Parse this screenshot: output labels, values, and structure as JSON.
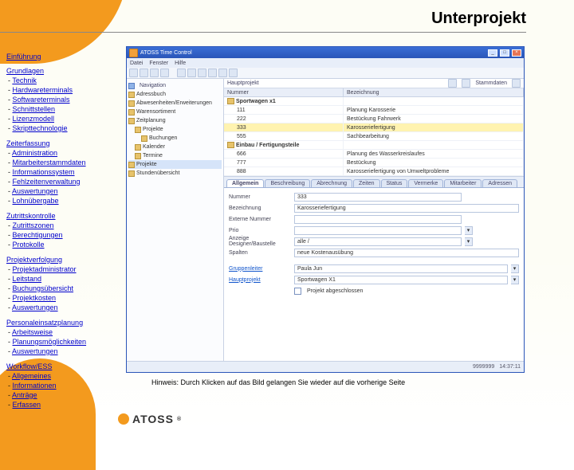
{
  "page": {
    "title": "Unterprojekt"
  },
  "nav": {
    "einfuehrung": "Einführung",
    "grundlagen": {
      "title": "Grundlagen",
      "items": [
        "Technik",
        "Hardwareterminals",
        "Softwareterminals",
        "Schnittstellen",
        "Lizenzmodell",
        "Skripttechnologie"
      ]
    },
    "zeiterfassung": {
      "title": "Zeiterfassung",
      "items": [
        "Administration",
        "Mitarbeiterstammdaten",
        "Informationssystem",
        "Fehlzeitenverwaltung",
        "Auswertungen",
        "Lohnübergabe"
      ]
    },
    "zutritt": {
      "title": "Zutrittskontrolle",
      "items": [
        "Zutrittszonen",
        "Berechtigungen",
        "Protokolle"
      ]
    },
    "projekt": {
      "title": "Projektverfolgung",
      "items": [
        "Projektadministrator",
        "Leitstand",
        "Buchungsübersicht",
        "Projektkosten",
        "Auswertungen"
      ]
    },
    "pep": {
      "title": "Personaleinsatzplanung",
      "items": [
        "Arbeitsweise",
        "Planungsmöglichkeiten",
        "Auswertungen"
      ]
    },
    "workflow": {
      "title": "Workflow/ESS",
      "items": [
        "Allgemeines",
        "Informationen",
        "Anträge",
        "Erfassen"
      ]
    }
  },
  "app": {
    "window_title": "ATOSS Time Control",
    "menu": [
      "Datei",
      "Fenster",
      "Hilfe"
    ],
    "win_buttons": {
      "min": "_",
      "max": "□",
      "close": "×"
    },
    "crumb": {
      "root": "Navigation",
      "current": "Stammdaten"
    },
    "tree": [
      {
        "d": 0,
        "label": "Adressbuch"
      },
      {
        "d": 0,
        "label": "Abwesenheiten/Erweiterungen"
      },
      {
        "d": 0,
        "label": "Warensortiment"
      },
      {
        "d": 0,
        "label": "Zeitplanung"
      },
      {
        "d": 1,
        "label": "Projekte"
      },
      {
        "d": 2,
        "label": "Buchungen"
      },
      {
        "d": 1,
        "label": "Kalender"
      },
      {
        "d": 1,
        "label": "Termine"
      },
      {
        "d": 0,
        "label": "Projekte",
        "sel": true
      },
      {
        "d": 0,
        "label": "Stundenübersicht"
      }
    ],
    "grid": {
      "headers": [
        "Nummer",
        "Bezeichnung"
      ],
      "breadcrumb": "Hauptprojekt",
      "rows": [
        {
          "group": true,
          "num": "Sportwagen x1",
          "desc": ""
        },
        {
          "num": "111",
          "desc": "Planung Karosserie"
        },
        {
          "num": "222",
          "desc": "Bestückung Fahrwerk"
        },
        {
          "num": "333",
          "desc": "Karosseriefertigung",
          "sel": true
        },
        {
          "num": "555",
          "desc": "Sachbearbeitung"
        },
        {
          "group": true,
          "num": "Einbau / Fertigungsteile",
          "desc": ""
        },
        {
          "num": "666",
          "desc": "Planung des Wasserkreislaufes"
        },
        {
          "num": "777",
          "desc": "Bestückung"
        },
        {
          "num": "888",
          "desc": "Karosseriefertigung von Umweltprobleme"
        }
      ]
    },
    "tabs": [
      "Allgemein",
      "Beschreibung",
      "Abrechnung",
      "Zeiten",
      "Status",
      "Vermerke",
      "Mitarbeiter",
      "Adressen"
    ],
    "active_tab": 0,
    "form": {
      "nummer_label": "Nummer",
      "nummer": "333",
      "bez_label": "Bezeichnung",
      "bez": "Karosseriefertigung",
      "ext_label": "Externe Nummer",
      "ext": "",
      "prio_label": "Prio",
      "prio": "",
      "anz_label": "Anzeige Designer/Baustelle",
      "anz": "alle /",
      "spalten_label": "Spalten",
      "spalten": "neue Kostenausübung",
      "gruppe_label": "Gruppenleiter",
      "gruppe": "Paula Jun",
      "haupt_label": "Hauptprojekt",
      "haupt": "Sportwagen X1",
      "chk_label": "Projekt abgeschlossen"
    },
    "status": {
      "count": "9999999",
      "time": "14:37:11"
    }
  },
  "hint": "Hinweis: Durch Klicken auf das Bild gelangen Sie wieder auf die vorherige Seite",
  "logo": "ATOSS"
}
